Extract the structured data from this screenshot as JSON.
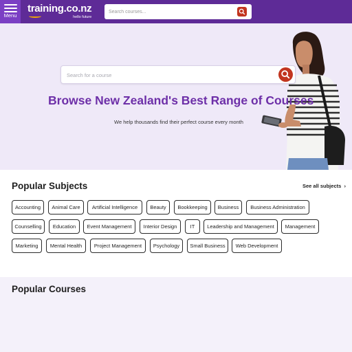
{
  "header": {
    "menu_label": "Menu",
    "logo_text": "training.co.nz",
    "logo_tagline": "hello future",
    "search_placeholder": "Search courses..."
  },
  "hero": {
    "search_placeholder": "Search for a course",
    "title": "Browse New Zealand's Best Range of Courses",
    "subtitle": "We help thousands find their perfect course every month"
  },
  "popular_subjects": {
    "title": "Popular Subjects",
    "see_all_label": "See all subjects",
    "chips": [
      "Accounting",
      "Animal Care",
      "Artificial Intelligence",
      "Beauty",
      "Bookkeeping",
      "Business",
      "Business Administration",
      "Counselling",
      "Education",
      "Event Management",
      "Interior Design",
      "IT",
      "Leadership and Management",
      "Management",
      "Marketing",
      "Mental Health",
      "Project Management",
      "Psychology",
      "Small Business",
      "Web Development"
    ]
  },
  "popular_courses": {
    "title": "Popular Courses"
  },
  "colors": {
    "header_bg": "#5e2b97",
    "menu_bg": "#7b3fc4",
    "hero_bg": "#efe9f8",
    "title_purple": "#6d2fa8",
    "search_button_red": "#c2351f",
    "logo_swoosh": "#f2a900"
  },
  "icons": {
    "menu": "hamburger-icon",
    "search": "search-icon",
    "chevron": "chevron-right-icon"
  }
}
